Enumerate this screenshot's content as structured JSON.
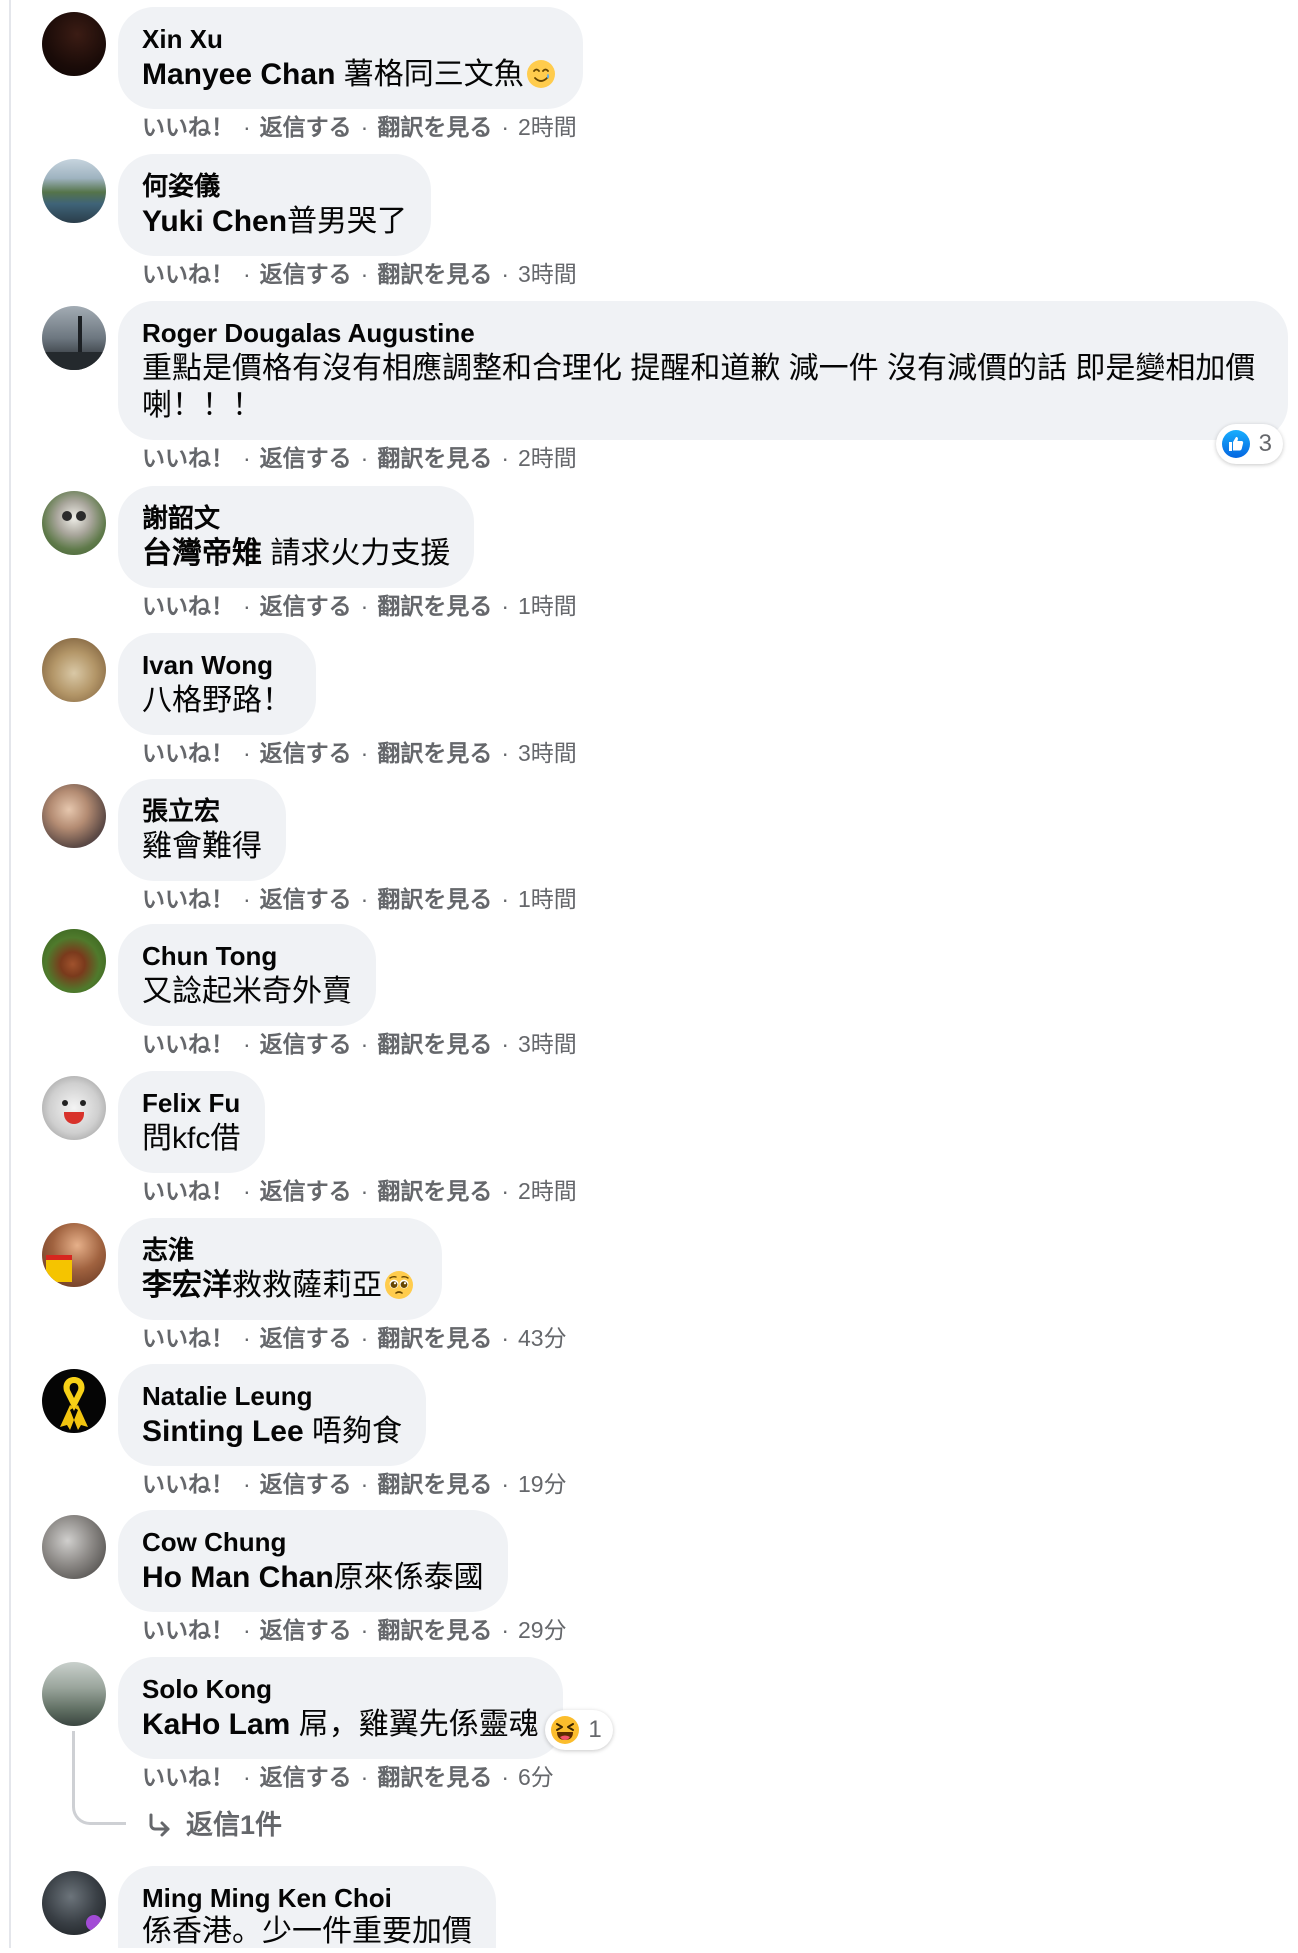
{
  "actions": {
    "like": "いいね！",
    "reply": "返信する",
    "translate": "翻訳を見る",
    "separator": "·"
  },
  "colors": {
    "bubble": "#f0f2f5",
    "meta_text": "#65676b",
    "like_blue": "#1877f2",
    "thread_line": "#ced0d4"
  },
  "comments": [
    {
      "author": "Xin Xu",
      "tag": "Manyee Chan",
      "text": " 薯格同三文魚",
      "emoji": "smiling-face-with-tear",
      "time": "2時間"
    },
    {
      "author": "何姿儀",
      "tag": "Yuki Chen",
      "text": "普男哭了",
      "time": "3時間"
    },
    {
      "author": "Roger Dougalas Augustine",
      "text": "重點是價格有沒有相應調整和合理化 提醒和道歉 減一件 沒有減價的話 即是變相加價喇！！！",
      "reaction": {
        "type": "like",
        "count": "3"
      },
      "time": "2時間"
    },
    {
      "author": "謝韶文",
      "tag": "台灣帝雉",
      "text": " 請求火力支援",
      "time": "1時間"
    },
    {
      "author": "Ivan Wong",
      "text": "八格野路！",
      "time": "3時間"
    },
    {
      "author": "張立宏",
      "text": "雞會難得",
      "time": "1時間"
    },
    {
      "author": "Chun Tong",
      "text": "又諗起米奇外賣",
      "time": "3時間"
    },
    {
      "author": "Felix Fu",
      "text": "問kfc借",
      "time": "2時間"
    },
    {
      "author": "志淮",
      "tag": "李宏洋",
      "text": "救救薩莉亞",
      "emoji": "pleading-face",
      "time": "43分"
    },
    {
      "author": "Natalie Leung",
      "tag": "Sinting Lee",
      "text": " 唔夠食",
      "time": "19分"
    },
    {
      "author": "Cow Chung",
      "tag": "Ho Man Chan",
      "text": "原來係泰國",
      "time": "29分"
    },
    {
      "author": "Solo Kong",
      "tag": "KaHo Lam",
      "text": " 屌，雞翼先係靈魂",
      "reaction": {
        "type": "haha",
        "count": "1"
      },
      "time": "6分",
      "replies_label": "返信1件"
    },
    {
      "author": "Ming Ming Ken Choi",
      "text": "係香港。少一件重要加價"
    }
  ]
}
